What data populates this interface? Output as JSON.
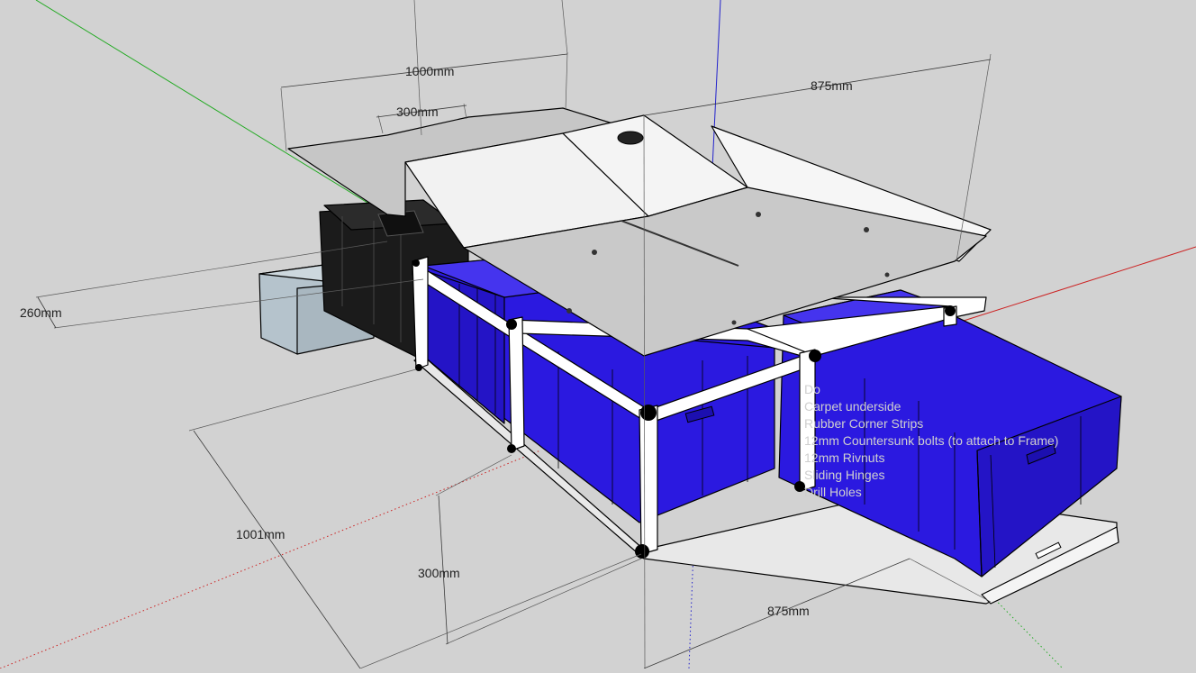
{
  "dimensions": {
    "top_width": "1000mm",
    "top_inner": "300mm",
    "top_depth": "875mm",
    "side_height": "260mm",
    "base_length": "1001mm",
    "base_height": "300mm",
    "base_depth": "875mm"
  },
  "overlay_notes": [
    "Do",
    "Carpet underside",
    "Rubber Corner Strips",
    "12mm Countersunk bolts (to attach to Frame)",
    "12mm Rivnuts",
    "Sliding Hinges",
    "Drill Holes"
  ],
  "colors": {
    "background": "#d2d2d2",
    "drawer_blue": "#2b19e0",
    "drawer_blue_dark": "#1c0fb0",
    "panel_grey": "#c6c6c6",
    "lid_white": "#f2f2f2",
    "frame_white": "#ffffff",
    "case_black": "#1b1b1b",
    "side_box": "#b5c3cc",
    "axis_red": "#cc2222",
    "axis_green": "#22aa22",
    "axis_blue": "#2222cc"
  }
}
